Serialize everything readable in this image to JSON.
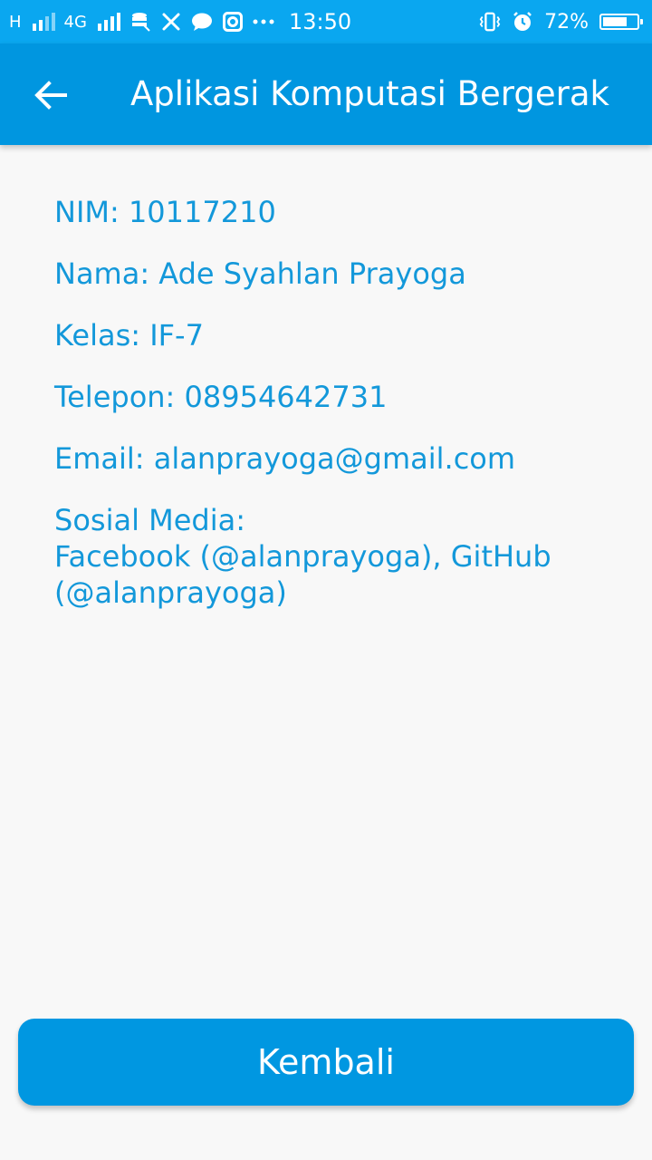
{
  "status_bar": {
    "network_h": "H",
    "network_4g": "4G",
    "time": "13:50",
    "battery_percent": "72%",
    "battery_level": 0.72,
    "icons": [
      "signal-icon",
      "storage-icon",
      "tools-icon",
      "chat-icon",
      "instagram-icon",
      "more-icon",
      "vibrate-icon",
      "alarm-icon",
      "battery-icon"
    ]
  },
  "app_bar": {
    "title": "Aplikasi Komputasi Bergerak",
    "back_icon": "arrow-left-icon"
  },
  "profile": {
    "nim": "NIM: 10117210",
    "nama": "Nama: Ade Syahlan Prayoga",
    "kelas": "Kelas: IF-7",
    "telepon": "Telepon: 08954642731",
    "email": "Email: alanprayoga@gmail.com",
    "sosial_media_label": "Sosial Media:",
    "sosial_media_value": "Facebook (@alanprayoga), GitHub (@alanprayoga)"
  },
  "actions": {
    "kembali_label": "Kembali"
  },
  "colors": {
    "status_bar": "#0aa7f0",
    "app_bar": "#0096e0",
    "text_accent": "#1398da",
    "button": "#0097e1",
    "background": "#f8f8f8"
  }
}
